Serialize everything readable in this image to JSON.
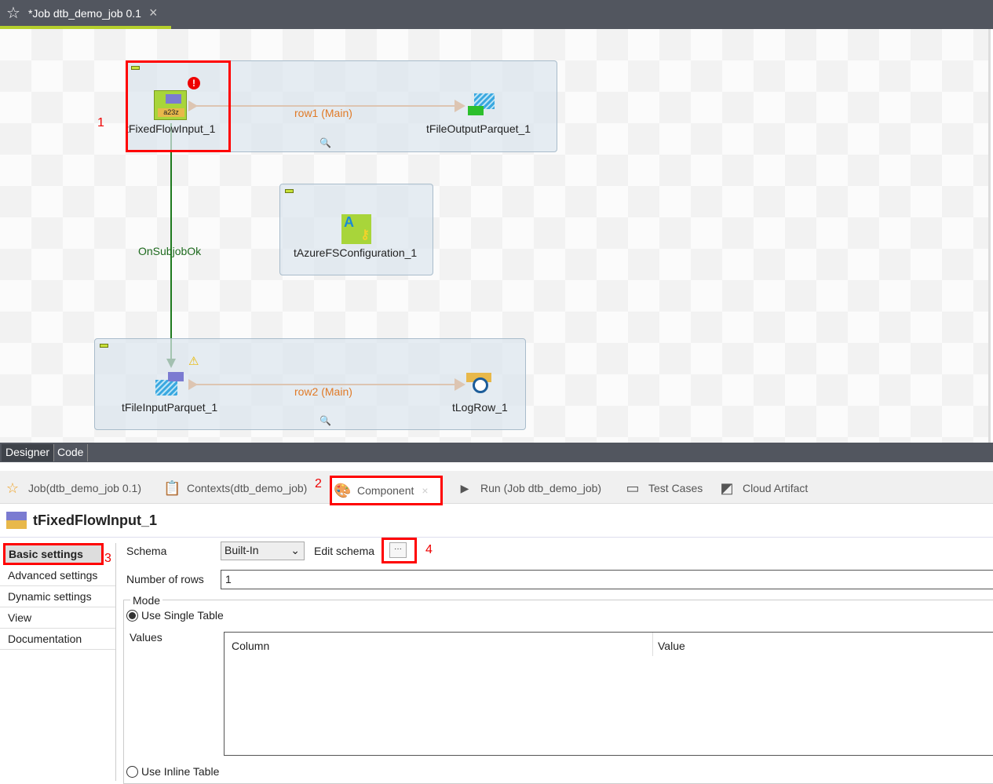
{
  "editor_tab": {
    "title": "*Job dtb_demo_job 0.1",
    "close": "×"
  },
  "canvas": {
    "components": {
      "fixed_flow": "tFixedFlowInput_1",
      "output_parquet": "tFileOutputParquet_1",
      "azure_config": "tAzureFSConfiguration_1",
      "input_parquet": "tFileInputParquet_1",
      "log_row": "tLogRow_1"
    },
    "links": {
      "row1": "row1 (Main)",
      "row2": "row2 (Main)",
      "trigger": "OnSubjobOk"
    },
    "annotations": [
      "1",
      "2",
      "3",
      "4"
    ]
  },
  "view_tabs": [
    "Designer",
    "Code"
  ],
  "panel_tabs": [
    {
      "label": "Job(dtb_demo_job 0.1)"
    },
    {
      "label": "Contexts(dtb_demo_job)"
    },
    {
      "label": "Component"
    },
    {
      "label": "Run (Job dtb_demo_job)"
    },
    {
      "label": "Test Cases"
    },
    {
      "label": "Cloud Artifact"
    }
  ],
  "component": {
    "title": "tFixedFlowInput_1",
    "sidebar": [
      "Basic settings",
      "Advanced settings",
      "Dynamic settings",
      "View",
      "Documentation"
    ],
    "schema_label": "Schema",
    "schema_value": "Built-In",
    "edit_schema_label": "Edit schema",
    "edit_schema_btn": "···",
    "rows_label": "Number of rows",
    "rows_value": "1",
    "mode_label": "Mode",
    "single_table": "Use Single Table",
    "values_label": "Values",
    "columns": [
      "Column",
      "Value"
    ],
    "inline_table": "Use Inline Table"
  },
  "colors": {
    "accent": "#b5cf2c",
    "flow": "#e07a27",
    "trigger": "#1e7a1e",
    "highlight": "#ff0000"
  }
}
